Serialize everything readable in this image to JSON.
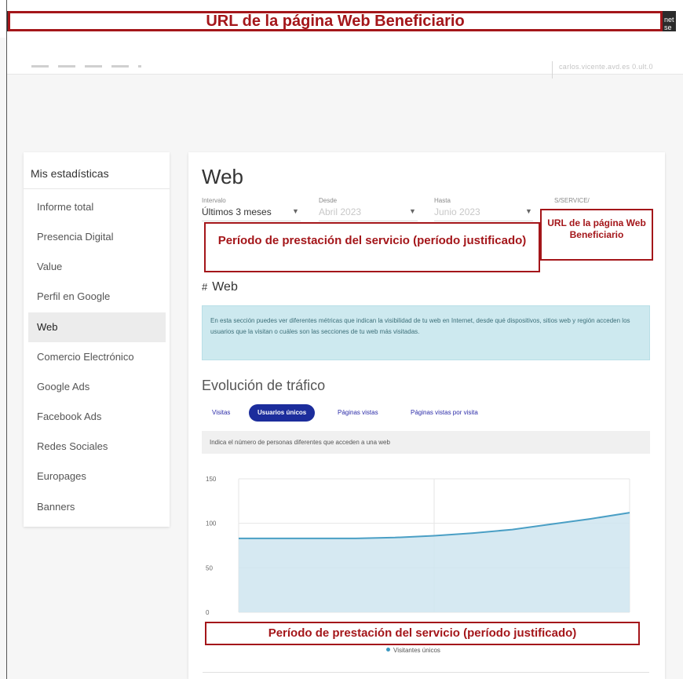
{
  "browser": {
    "url_annotation": "URL de la página Web Beneficiario",
    "url_tail": "net se"
  },
  "header": {
    "user_text": "carlos.vicente.avd.es 0.ult.0"
  },
  "sidebar": {
    "title": "Mis estadísticas",
    "items": [
      {
        "label": "Informe total",
        "active": false
      },
      {
        "label": "Presencia Digital",
        "active": false
      },
      {
        "label": "Value",
        "active": false
      },
      {
        "label": "Perfil en Google",
        "active": false
      },
      {
        "label": "Web",
        "active": true
      },
      {
        "label": "Comercio Electrónico",
        "active": false
      },
      {
        "label": "Google Ads",
        "active": false
      },
      {
        "label": "Facebook Ads",
        "active": false
      },
      {
        "label": "Redes Sociales",
        "active": false
      },
      {
        "label": "Europages",
        "active": false
      },
      {
        "label": "Banners",
        "active": false
      }
    ]
  },
  "main": {
    "title": "Web",
    "filters": {
      "interval_label": "Intervalo",
      "interval_value": "Últimos 3 meses",
      "from_label": "Desde",
      "from_value": "Abril 2023",
      "to_label": "Hasta",
      "to_value": "Junio 2023",
      "service_label": "S/SERVICE/"
    },
    "annotations": {
      "period": "Período de prestación del servicio (período justificado)",
      "url_box": "URL de la página Web Beneficiario",
      "period_chart": "Período de prestación del servicio (período justificado)"
    },
    "section_title": "Web",
    "info_text": "En esta sección puedes ver diferentes métricas que indican la visibilidad de tu web en Internet, desde qué dispositivos, sitios web y región acceden los usuarios que la visitan o cuáles son las secciones de tu web más visitadas.",
    "traffic_title": "Evolución de tráfico",
    "tabs": [
      {
        "label": "Visitas",
        "active": false
      },
      {
        "label": "Usuarios únicos",
        "active": true
      },
      {
        "label": "Páginas vistas",
        "active": false
      },
      {
        "label": "Páginas vistas por visita",
        "active": false
      }
    ],
    "tab_description": "Indica el número de personas diferentes que acceden a una web"
  },
  "chart_data": {
    "type": "area",
    "x": [
      0,
      1,
      2,
      3,
      4,
      5,
      6,
      7,
      8,
      9,
      10
    ],
    "series": [
      {
        "name": "Visitantes únicos",
        "values": [
          83,
          83,
          83,
          83,
          84,
          86,
          89,
          93,
          99,
          105,
          112
        ]
      }
    ],
    "ylim": [
      0,
      150
    ],
    "yticks": [
      0,
      50,
      100,
      150
    ],
    "grid": true,
    "legend": "bottom-center",
    "colors": {
      "line": "#4a9fc5",
      "fill": "#cfe5f0"
    }
  }
}
